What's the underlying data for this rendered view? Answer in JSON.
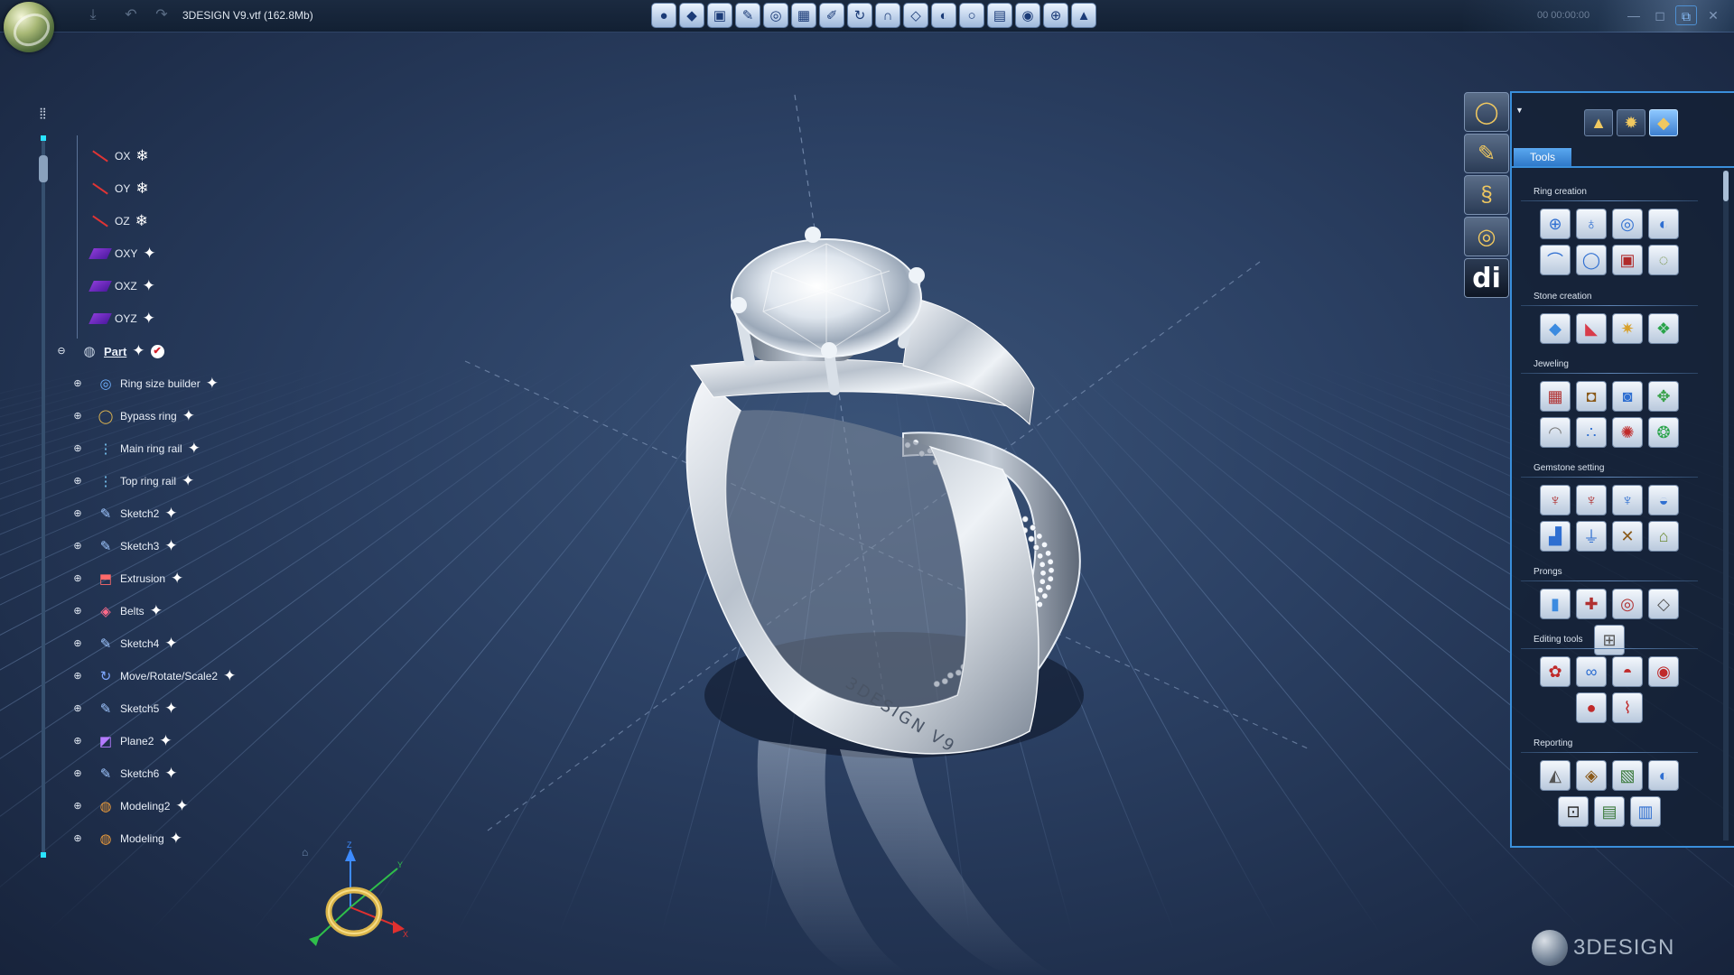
{
  "window": {
    "title": "3DESIGN V9.vtf  (162.8Mb)",
    "time": "00 00:00:00"
  },
  "toolbar": {
    "icons": [
      "sphere-icon",
      "gem-icon",
      "cube-icon",
      "ruler-icon",
      "ring-size-icon",
      "grid-icon",
      "edit-icon",
      "rotate-icon",
      "magnet-icon",
      "stone-icon",
      "render-icon",
      "ring-icon",
      "layout-icon",
      "tag-icon",
      "target-icon",
      "cone-icon"
    ],
    "glyphs": [
      "●",
      "◆",
      "▣",
      "✎",
      "◎",
      "▦",
      "✐",
      "↻",
      "∩",
      "◇",
      "◐",
      "○",
      "▤",
      "◉",
      "⊕",
      "▲"
    ]
  },
  "tree": {
    "rows": [
      {
        "label": "OX",
        "kind": "axis",
        "marker": "❄"
      },
      {
        "label": "OY",
        "kind": "axis",
        "marker": "❄"
      },
      {
        "label": "OZ",
        "kind": "axis",
        "marker": "❄"
      },
      {
        "label": "OXY",
        "kind": "plane",
        "marker": "✦"
      },
      {
        "label": "OXZ",
        "kind": "plane",
        "marker": "✦"
      },
      {
        "label": "OYZ",
        "kind": "plane",
        "marker": "✦"
      },
      {
        "label": "Part",
        "kind": "part",
        "marker": "✦"
      },
      {
        "label": "Ring size builder",
        "kind": "item",
        "icon": "◎",
        "iconColor": "#6fb2ff",
        "marker": "✦"
      },
      {
        "label": "Bypass ring",
        "kind": "item",
        "icon": "◯",
        "iconColor": "#e0b650",
        "marker": "✦"
      },
      {
        "label": "Main ring rail",
        "kind": "item",
        "icon": "⋮",
        "iconColor": "#7fd0ff",
        "marker": "✦"
      },
      {
        "label": "Top ring rail",
        "kind": "item",
        "icon": "⋮",
        "iconColor": "#7fd0ff",
        "marker": "✦"
      },
      {
        "label": "Sketch2",
        "kind": "item",
        "icon": "✎",
        "iconColor": "#9fc6ff",
        "marker": "✦"
      },
      {
        "label": "Sketch3",
        "kind": "item",
        "icon": "✎",
        "iconColor": "#9fc6ff",
        "marker": "✦"
      },
      {
        "label": "Extrusion",
        "kind": "item",
        "icon": "⬒",
        "iconColor": "#ff6a6a",
        "marker": "✦"
      },
      {
        "label": "Belts",
        "kind": "item",
        "icon": "◈",
        "iconColor": "#ff6a8a",
        "marker": "✦"
      },
      {
        "label": "Sketch4",
        "kind": "item",
        "icon": "✎",
        "iconColor": "#9fc6ff",
        "marker": "✦"
      },
      {
        "label": "Move/Rotate/Scale2",
        "kind": "item",
        "icon": "↻",
        "iconColor": "#7fa8ff",
        "marker": "✦"
      },
      {
        "label": "Sketch5",
        "kind": "item",
        "icon": "✎",
        "iconColor": "#9fc6ff",
        "marker": "✦"
      },
      {
        "label": "Plane2",
        "kind": "item",
        "icon": "◩",
        "iconColor": "#b57bff",
        "marker": "✦"
      },
      {
        "label": "Sketch6",
        "kind": "item",
        "icon": "✎",
        "iconColor": "#9fc6ff",
        "marker": "✦"
      },
      {
        "label": "Modeling2",
        "kind": "item",
        "icon": "◍",
        "iconColor": "#e89a3c",
        "marker": "✦"
      },
      {
        "label": "Modeling",
        "kind": "item",
        "icon": "◍",
        "iconColor": "#e89a3c",
        "marker": "✦"
      }
    ]
  },
  "gizmo": {
    "z": "Z",
    "y": "Y",
    "x": "X"
  },
  "side_categories": [
    {
      "name": "ring-category-icon",
      "glyph": "◯"
    },
    {
      "name": "sketch-category-icon",
      "glyph": "✎"
    },
    {
      "name": "snake-category-icon",
      "glyph": "§"
    },
    {
      "name": "band-category-icon",
      "glyph": "◎"
    },
    {
      "name": "di-category-icon",
      "glyph": "di"
    }
  ],
  "panel": {
    "arrow": "▼",
    "modes": [
      {
        "name": "shapes-mode-icon",
        "glyph": "▲"
      },
      {
        "name": "gear-mode-icon",
        "glyph": "✹"
      },
      {
        "name": "tools-mode-icon",
        "glyph": "◆"
      }
    ],
    "tab": "Tools",
    "sections": [
      {
        "title": "Ring creation",
        "icons": [
          "⊕",
          "♁",
          "◎",
          "◐",
          "⌒",
          "◯",
          "▣",
          "◌"
        ],
        "colors": [
          "#2f6fd1",
          "#2f6fd1",
          "#2f6fd1",
          "#2f6fd1",
          "#2f6fd1",
          "#2f6fd1",
          "#b02a2a",
          "#6c8a32"
        ]
      },
      {
        "title": "Stone creation",
        "icons": [
          "◆",
          "◣",
          "✷",
          "❖"
        ],
        "colors": [
          "#3c8be0",
          "#d83c4a",
          "#d8a02a",
          "#2aa44a"
        ]
      },
      {
        "title": "Jeweling",
        "icons": [
          "▦",
          "◘",
          "◙",
          "✥",
          "◠",
          "∴",
          "✺",
          "❂"
        ],
        "colors": [
          "#b03030",
          "#8a5a1a",
          "#2f6fd1",
          "#3aa24a",
          "#7a7a7a",
          "#2f6fd1",
          "#c02a2a",
          "#2aa44a"
        ]
      },
      {
        "title": "Gemstone setting",
        "icons": [
          "♆",
          "♆",
          "♆",
          "◒",
          "▟",
          "⏚",
          "✕",
          "⌂"
        ],
        "colors": [
          "#b03030",
          "#b03030",
          "#2f6fd1",
          "#2f6fd1",
          "#2f6fd1",
          "#2f6fd1",
          "#8a5a1a",
          "#6c8a32"
        ]
      },
      {
        "title": "Prongs",
        "icons": [
          "▮",
          "✚",
          "◎",
          "◇",
          "⊞"
        ],
        "colors": [
          "#3c8be0",
          "#b03030",
          "#b03030",
          "#555555",
          "#555555"
        ]
      },
      {
        "title": "Editing tools",
        "icons": [
          "✿",
          "∞",
          "◓",
          "◉",
          "●",
          "⌇"
        ],
        "colors": [
          "#c02a2a",
          "#2f6fd1",
          "#c02a2a",
          "#c02a2a",
          "#c02a2a",
          "#c02a2a"
        ]
      },
      {
        "title": "Reporting",
        "icons": [
          "◭",
          "◈",
          "▧",
          "◐",
          "⊡",
          "▤",
          "▥"
        ],
        "colors": [
          "#555555",
          "#8a5a1a",
          "#3a7a3a",
          "#2f6fd1",
          "#222222",
          "#3a7a3a",
          "#2f6fd1"
        ]
      }
    ]
  },
  "brand": {
    "text": "3DESIGN"
  },
  "engraving": "3DESIGN V9"
}
